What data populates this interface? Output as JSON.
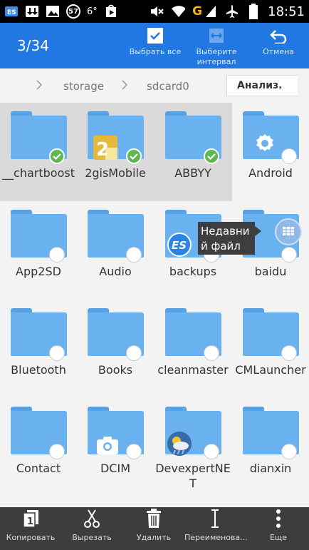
{
  "status_bar": {
    "badge": "57",
    "temperature": "6°",
    "network_letter": "G",
    "time": "18:51",
    "icons": [
      "es-app-icon",
      "download-icon",
      "image-icon",
      "badge-57",
      "temp-icon",
      "play-store-icon",
      "mute-icon",
      "wifi-icon",
      "signal-icon",
      "airplane-icon",
      "battery-icon"
    ]
  },
  "action_bar": {
    "counter": "3/34",
    "select_all": "Выбрать все",
    "select_range_1": "Выберите",
    "select_range_2": "интервал",
    "cancel": "Отмена"
  },
  "breadcrumb": {
    "items": [
      "storage",
      "sdcard0"
    ],
    "analyze_button": "Анализ."
  },
  "files": [
    {
      "name": "__chartboost",
      "selected": true
    },
    {
      "name": "2gisMobile",
      "selected": true
    },
    {
      "name": "ABBYY",
      "selected": true
    },
    {
      "name": "Android",
      "selected": false
    },
    {
      "name": "App2SD",
      "selected": false
    },
    {
      "name": "Audio",
      "selected": false
    },
    {
      "name": "backups",
      "selected": false
    },
    {
      "name": "baidu",
      "selected": false
    },
    {
      "name": "Bluetooth",
      "selected": false
    },
    {
      "name": "Books",
      "selected": false
    },
    {
      "name": "cleanmaster",
      "selected": false
    },
    {
      "name": "CMLauncher",
      "selected": false
    },
    {
      "name": "Contact",
      "selected": false
    },
    {
      "name": "DCIM",
      "selected": false
    },
    {
      "name": "DevexpertNET",
      "selected": false
    },
    {
      "name": "dianxin",
      "selected": false
    }
  ],
  "tooltip": {
    "text_1": "Недавни",
    "text_2": "й файл"
  },
  "bottom_bar": {
    "copy": "Копировать",
    "cut": "Вырезать",
    "delete": "Удалить",
    "rename": "Переименова...",
    "more": "Еще"
  },
  "colors": {
    "action_bar": "#2278e2",
    "folder": "#6ab2ef",
    "check": "#5db94d",
    "bottom_bar": "#3d3d3d"
  }
}
